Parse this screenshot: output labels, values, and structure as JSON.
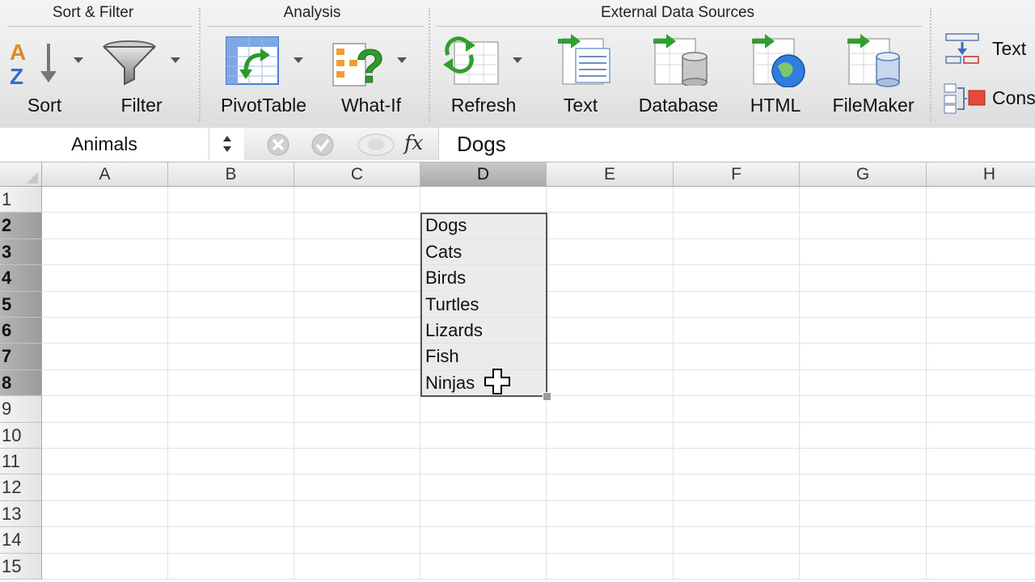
{
  "ribbon": {
    "groups": {
      "sort_filter": "Sort & Filter",
      "analysis": "Analysis",
      "external": "External Data Sources"
    },
    "tools": {
      "sort": "Sort",
      "filter": "Filter",
      "pivot": "PivotTable",
      "whatif": "What-If",
      "refresh": "Refresh",
      "text": "Text",
      "database": "Database",
      "html": "HTML",
      "filemaker": "FileMaker"
    },
    "side": {
      "text_to_columns": "Text",
      "consolidate": "Cons"
    }
  },
  "formula_bar": {
    "name_box": "Animals",
    "fx": "fx",
    "content": "Dogs"
  },
  "grid": {
    "columns": [
      "A",
      "B",
      "C",
      "D",
      "E",
      "F",
      "G",
      "H"
    ],
    "rows": [
      "1",
      "2",
      "3",
      "4",
      "5",
      "6",
      "7",
      "8",
      "9",
      "10",
      "11",
      "12",
      "13",
      "14",
      "15"
    ],
    "selected_column": "D",
    "selected_rows": [
      "2",
      "3",
      "4",
      "5",
      "6",
      "7",
      "8"
    ],
    "column_d_values": [
      "",
      "Dogs",
      "Cats",
      "Birds",
      "Turtles",
      "Lizards",
      "Fish",
      "Ninjas"
    ]
  },
  "colors": {
    "selection_border": "#555555",
    "selection_fill": "#ebebeb",
    "header_selected": "#a9a9a9"
  }
}
